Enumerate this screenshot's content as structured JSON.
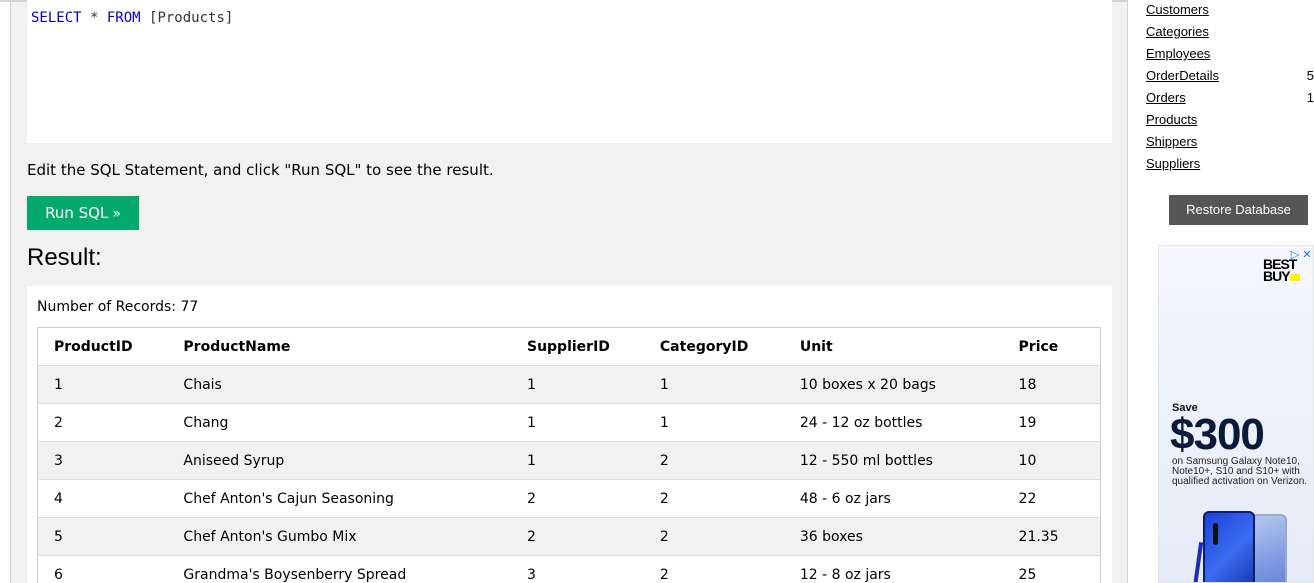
{
  "editor": {
    "sql_keyword_select": "SELECT",
    "sql_star": " * ",
    "sql_keyword_from": "FROM",
    "sql_table": " [Products]"
  },
  "hint_text": "Edit the SQL Statement, and click \"Run SQL\" to see the result.",
  "run_button": {
    "label": "Run SQL",
    "chevron": "»"
  },
  "result": {
    "title": "Result:",
    "record_count_label": "Number of Records: 77",
    "columns": [
      "ProductID",
      "ProductName",
      "SupplierID",
      "CategoryID",
      "Unit",
      "Price"
    ],
    "rows": [
      [
        "1",
        "Chais",
        "1",
        "1",
        "10 boxes x 20 bags",
        "18"
      ],
      [
        "2",
        "Chang",
        "1",
        "1",
        "24 - 12 oz bottles",
        "19"
      ],
      [
        "3",
        "Aniseed Syrup",
        "1",
        "2",
        "12 - 550 ml bottles",
        "10"
      ],
      [
        "4",
        "Chef Anton's Cajun Seasoning",
        "2",
        "2",
        "48 - 6 oz jars",
        "22"
      ],
      [
        "5",
        "Chef Anton's Gumbo Mix",
        "2",
        "2",
        "36 boxes",
        "21.35"
      ],
      [
        "6",
        "Grandma's Boysenberry Spread",
        "3",
        "2",
        "12 - 8 oz jars",
        "25"
      ]
    ]
  },
  "sidebar": {
    "tables": [
      {
        "name": "Customers",
        "count": ""
      },
      {
        "name": "Categories",
        "count": ""
      },
      {
        "name": "Employees",
        "count": ""
      },
      {
        "name": "OrderDetails",
        "count": "5"
      },
      {
        "name": "Orders",
        "count": "1"
      },
      {
        "name": "Products",
        "count": ""
      },
      {
        "name": "Shippers",
        "count": ""
      },
      {
        "name": "Suppliers",
        "count": ""
      }
    ],
    "restore_button": "Restore Database"
  },
  "ad": {
    "brand": "BEST BUY",
    "save_label": "Save",
    "amount": "$300",
    "fine_print": "on Samsung Galaxy Note10, Note10+, S10 and S10+ with qualified activation on Verizon.",
    "controls": [
      "▷",
      "✕"
    ]
  },
  "colors": {
    "run_button": "#04aa6d",
    "restore_button": "#555555",
    "sql_keyword": "#0000cd",
    "panel_bg": "#f1f1f1"
  }
}
